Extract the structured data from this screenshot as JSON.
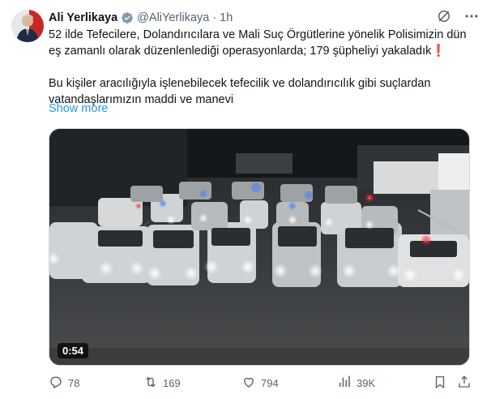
{
  "author": {
    "name": "Ali Yerlikaya",
    "handle": "@AliYerlikaya",
    "separator": "·",
    "time": "1h"
  },
  "tweet": {
    "paragraph1": "52 ilde Tefecilere, Dolandırıcılara ve Mali Suç Örgütlerine yönelik Polisimizin dün eş zamanlı olarak  düzenlenlediği operasyonlarda; 179 şüpheliyi yakaladık❗",
    "paragraph2": "Bu kişiler aracılığıyla işlenebilecek tefecilik ve dolandırıcılık gibi suçlardan vatandaşlarımızın maddi ve manevi",
    "show_more": "Show more"
  },
  "media": {
    "duration": "0:54",
    "description_icon": "video-thumbnail"
  },
  "stats": {
    "replies": "78",
    "reposts": "169",
    "likes": "794",
    "views": "39K"
  },
  "colors": {
    "accent": "#1d9bf0",
    "secondary_text": "#536471",
    "verified_badge": "#829aab"
  },
  "icons": [
    "verified-badge-icon",
    "grok-icon",
    "more-icon",
    "reply-icon",
    "repost-icon",
    "like-icon",
    "views-icon",
    "bookmark-icon",
    "share-icon"
  ]
}
